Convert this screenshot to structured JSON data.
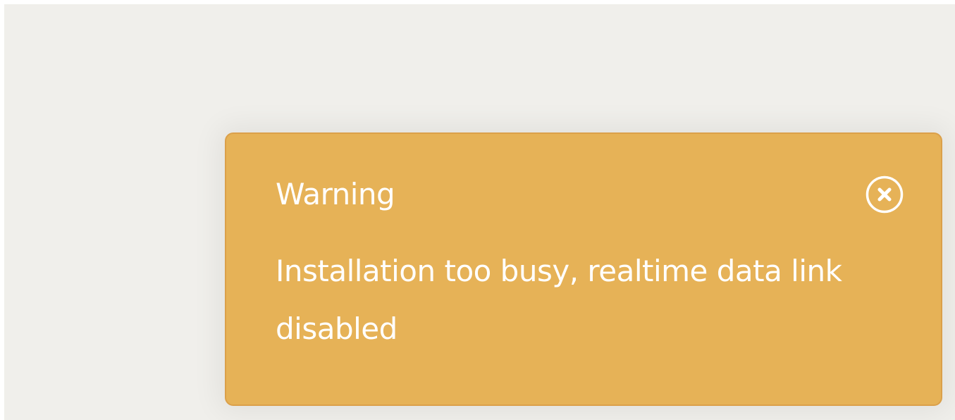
{
  "notification": {
    "title": "Warning",
    "message": "Installation too busy, realtime data link disabled",
    "close_icon": "close-circle-icon",
    "colors": {
      "background": "#e6b257",
      "border": "#dba04a",
      "text": "#ffffff",
      "page_background": "#f0efeb"
    }
  }
}
